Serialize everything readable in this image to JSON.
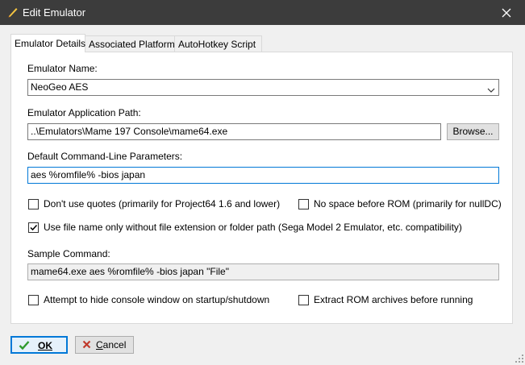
{
  "window": {
    "title": "Edit Emulator"
  },
  "tabs": [
    {
      "label": "Emulator Details"
    },
    {
      "label": "Associated Platforms"
    },
    {
      "label": "AutoHotkey Script"
    }
  ],
  "form": {
    "name_label": "Emulator Name:",
    "name_value": "NeoGeo AES",
    "path_label": "Emulator Application Path:",
    "path_value": "..\\Emulators\\Mame 197 Console\\mame64.exe",
    "browse_label": "Browse...",
    "params_label": "Default Command-Line Parameters:",
    "params_value": "aes %romfile% -bios japan",
    "sample_label": "Sample Command:",
    "sample_value": "mame64.exe aes %romfile% -bios japan \"File\""
  },
  "options": {
    "no_quotes": {
      "label": "Don't use quotes (primarily for Project64 1.6 and lower)",
      "checked": false
    },
    "no_space": {
      "label": "No space before ROM (primarily for nullDC)",
      "checked": false
    },
    "filename_only": {
      "label": "Use file name only without file extension or folder path (Sega Model 2 Emulator, etc. compatibility)",
      "checked": true
    },
    "hide_console": {
      "label": "Attempt to hide console window on startup/shutdown",
      "checked": false
    },
    "extract_rom": {
      "label": "Extract ROM archives before running",
      "checked": false
    }
  },
  "buttons": {
    "ok_label": "OK",
    "cancel_label": "Cancel"
  },
  "colors": {
    "titlebar": "#3c3c3c",
    "accent": "#0078d7",
    "ok_check": "#2e9a2e",
    "cancel_x": "#c0392b"
  }
}
